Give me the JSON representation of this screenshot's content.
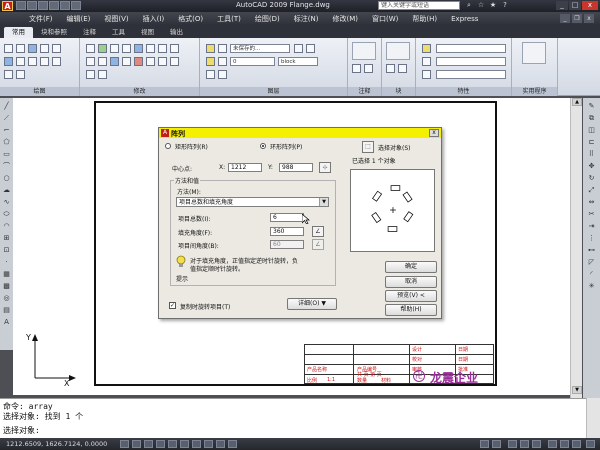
{
  "titlebar": {
    "app_letter": "A",
    "title": "AutoCAD 2009 Flange.dwg",
    "search_placeholder": "键入关键字或短语",
    "min_label": "_",
    "max_label": "□",
    "close_label": "x"
  },
  "menubar": {
    "items": [
      "文件(F)",
      "编辑(E)",
      "视图(V)",
      "插入(I)",
      "格式(O)",
      "工具(T)",
      "绘图(D)",
      "标注(N)",
      "修改(M)",
      "窗口(W)",
      "帮助(H)",
      "Express"
    ]
  },
  "ribbon": {
    "tabs": [
      "常用",
      "块和参照",
      "注释",
      "工具",
      "视图",
      "输出"
    ],
    "active_tab": "常用",
    "panels": [
      {
        "title": "绘图"
      },
      {
        "title": "修改"
      },
      {
        "title": "图层"
      },
      {
        "title": "注释"
      },
      {
        "title": "块"
      },
      {
        "title": "特性"
      },
      {
        "title": "实用程序"
      }
    ],
    "layer_combo": "未保存的...",
    "layer_name": "0",
    "color_combo": "block"
  },
  "dialog": {
    "title": "阵列",
    "close_label": "x",
    "rect_array_label": "矩形阵列(R)",
    "polar_array_label": "环形阵列(P)",
    "select_objects_label": "选择对象(S)",
    "selected_count_text": "已选择 1 个对象",
    "center_label": "中心点:",
    "x_label": "X:",
    "x_value": "1212",
    "y_label": "Y:",
    "y_value": "988",
    "method_group_label": "方法和值",
    "method_label": "方法(M):",
    "method_value": "项目总数和填充角度",
    "total_items_label": "项目总数(I):",
    "total_items_value": "6",
    "fill_angle_label": "填充角度(F):",
    "fill_angle_value": "360",
    "angle_between_label": "项目间角度(B):",
    "angle_between_value": "60",
    "hint_text_1": "对于填充角度，正值指定逆时针旋转，负",
    "hint_text_2": "值指定顺时针旋转。",
    "hint_label": "提示",
    "rotate_items_label": "复制时旋转项目(T)",
    "rotate_items_checked": true,
    "more_button": "详细(O) ▼",
    "ok_button": "确定",
    "cancel_button": "取消",
    "preview_button": "预览(V) <",
    "help_button": "帮助(H)"
  },
  "titleblock": {
    "labels": [
      "设计",
      "日期",
      "校对",
      "日期",
      "产品名称",
      "产品编号",
      "共 页 第 页",
      "比例",
      "1:1",
      "数量",
      "材料",
      "审核",
      "批准"
    ],
    "company": "龙震企业"
  },
  "command": {
    "lines": [
      "命令:  array",
      "选择对象: 找到 1 个",
      "选择对象:"
    ]
  },
  "status": {
    "coords": "1212.6509, 1626.7124, 0.0000"
  },
  "colors": {
    "dialog_title": "#f5f000",
    "title_accent": "#c11111",
    "company_logo": "#9a2d9a"
  }
}
